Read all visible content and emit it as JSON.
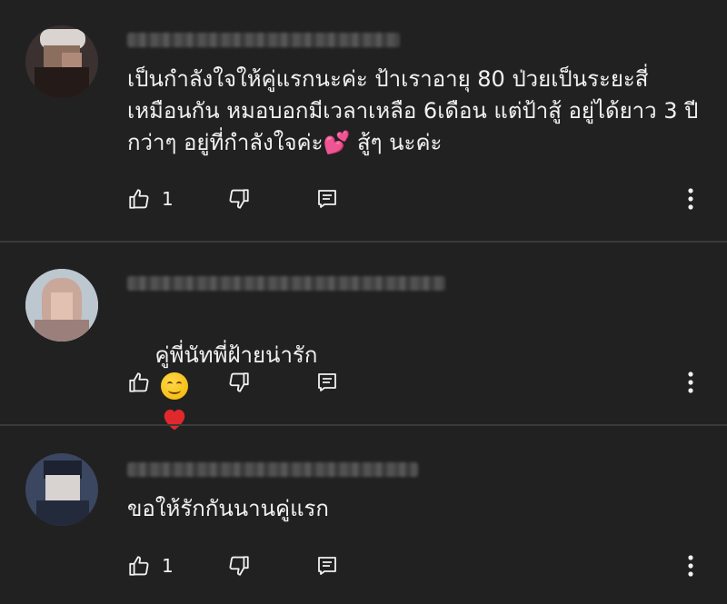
{
  "comments": [
    {
      "text": "เป็นกำลังใจให้คู่แรกนะค่ะ ป้าเราอายุ 80 ป่วยเป็นระยะสี่ เหมือนกัน หมอบอกมีเวลาเหลือ 6เดือน แต่ป้าสู้ อยู่ได้ยาว 3 ปีกว่าๆ อยู่ที่กำลังใจค่ะ💕 สู้ๆ นะค่ะ",
      "like_count": "1"
    },
    {
      "text": "คู่พี่นัทพี่ฝ้ายน่ารัก",
      "like_count": ""
    },
    {
      "text": "ขอให้รักกันนานคู่แรก",
      "like_count": "1"
    }
  ],
  "colors": {
    "background": "#212121",
    "text": "#f1f1f1",
    "divider": "#3a3a3a",
    "icon": "#f1f1f1"
  },
  "icons": {
    "like": "thumbs-up-icon",
    "dislike": "thumbs-down-icon",
    "reply": "reply-comment-icon",
    "more": "more-vert-icon"
  }
}
